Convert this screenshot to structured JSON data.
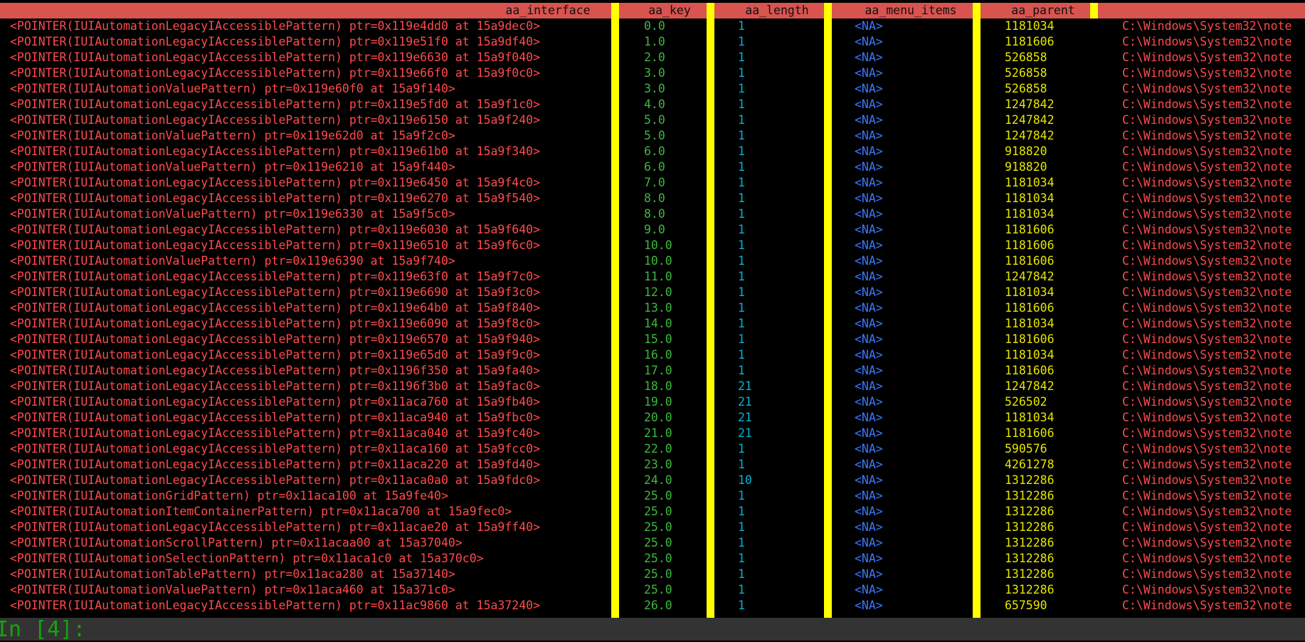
{
  "colors": {
    "header_bg": "#d9534f",
    "separator": "#ffff00",
    "interface_text": "#ff4b4b",
    "key_text": "#3cb93c",
    "length_text": "#00b4d4",
    "menu_items_text": "#3b78ff",
    "parent_text": "#e6e600",
    "path_text": "#ff4b4b",
    "prompt_text": "#14a314",
    "prompt_bg": "#333333"
  },
  "table": {
    "columns": [
      "aa_interface",
      "aa_key",
      "aa_length",
      "aa_menu_items",
      "aa_parent"
    ],
    "rows": [
      {
        "interface": "<POINTER(IUIAutomationLegacyIAccessiblePattern) ptr=0x119e4dd0 at 15a9dec0>",
        "key": "0.0",
        "length": "1",
        "menu_items": "<NA>",
        "parent": "1181034",
        "path": "C:\\Windows\\System32\\note"
      },
      {
        "interface": "<POINTER(IUIAutomationLegacyIAccessiblePattern) ptr=0x119e51f0 at 15a9df40>",
        "key": "1.0",
        "length": "1",
        "menu_items": "<NA>",
        "parent": "1181606",
        "path": "C:\\Windows\\System32\\note"
      },
      {
        "interface": "<POINTER(IUIAutomationLegacyIAccessiblePattern) ptr=0x119e6630 at 15a9f040>",
        "key": "2.0",
        "length": "1",
        "menu_items": "<NA>",
        "parent": "526858",
        "path": "C:\\Windows\\System32\\note"
      },
      {
        "interface": "<POINTER(IUIAutomationLegacyIAccessiblePattern) ptr=0x119e66f0 at 15a9f0c0>",
        "key": "3.0",
        "length": "1",
        "menu_items": "<NA>",
        "parent": "526858",
        "path": "C:\\Windows\\System32\\note"
      },
      {
        "interface": "<POINTER(IUIAutomationValuePattern) ptr=0x119e60f0 at 15a9f140>",
        "key": "3.0",
        "length": "1",
        "menu_items": "<NA>",
        "parent": "526858",
        "path": "C:\\Windows\\System32\\note"
      },
      {
        "interface": "<POINTER(IUIAutomationLegacyIAccessiblePattern) ptr=0x119e5fd0 at 15a9f1c0>",
        "key": "4.0",
        "length": "1",
        "menu_items": "<NA>",
        "parent": "1247842",
        "path": "C:\\Windows\\System32\\note"
      },
      {
        "interface": "<POINTER(IUIAutomationLegacyIAccessiblePattern) ptr=0x119e6150 at 15a9f240>",
        "key": "5.0",
        "length": "1",
        "menu_items": "<NA>",
        "parent": "1247842",
        "path": "C:\\Windows\\System32\\note"
      },
      {
        "interface": "<POINTER(IUIAutomationValuePattern) ptr=0x119e62d0 at 15a9f2c0>",
        "key": "5.0",
        "length": "1",
        "menu_items": "<NA>",
        "parent": "1247842",
        "path": "C:\\Windows\\System32\\note"
      },
      {
        "interface": "<POINTER(IUIAutomationLegacyIAccessiblePattern) ptr=0x119e61b0 at 15a9f340>",
        "key": "6.0",
        "length": "1",
        "menu_items": "<NA>",
        "parent": "918820",
        "path": "C:\\Windows\\System32\\note"
      },
      {
        "interface": "<POINTER(IUIAutomationValuePattern) ptr=0x119e6210 at 15a9f440>",
        "key": "6.0",
        "length": "1",
        "menu_items": "<NA>",
        "parent": "918820",
        "path": "C:\\Windows\\System32\\note"
      },
      {
        "interface": "<POINTER(IUIAutomationLegacyIAccessiblePattern) ptr=0x119e6450 at 15a9f4c0>",
        "key": "7.0",
        "length": "1",
        "menu_items": "<NA>",
        "parent": "1181034",
        "path": "C:\\Windows\\System32\\note"
      },
      {
        "interface": "<POINTER(IUIAutomationLegacyIAccessiblePattern) ptr=0x119e6270 at 15a9f540>",
        "key": "8.0",
        "length": "1",
        "menu_items": "<NA>",
        "parent": "1181034",
        "path": "C:\\Windows\\System32\\note"
      },
      {
        "interface": "<POINTER(IUIAutomationValuePattern) ptr=0x119e6330 at 15a9f5c0>",
        "key": "8.0",
        "length": "1",
        "menu_items": "<NA>",
        "parent": "1181034",
        "path": "C:\\Windows\\System32\\note"
      },
      {
        "interface": "<POINTER(IUIAutomationLegacyIAccessiblePattern) ptr=0x119e6030 at 15a9f640>",
        "key": "9.0",
        "length": "1",
        "menu_items": "<NA>",
        "parent": "1181606",
        "path": "C:\\Windows\\System32\\note"
      },
      {
        "interface": "<POINTER(IUIAutomationLegacyIAccessiblePattern) ptr=0x119e6510 at 15a9f6c0>",
        "key": "10.0",
        "length": "1",
        "menu_items": "<NA>",
        "parent": "1181606",
        "path": "C:\\Windows\\System32\\note"
      },
      {
        "interface": "<POINTER(IUIAutomationValuePattern) ptr=0x119e6390 at 15a9f740>",
        "key": "10.0",
        "length": "1",
        "menu_items": "<NA>",
        "parent": "1181606",
        "path": "C:\\Windows\\System32\\note"
      },
      {
        "interface": "<POINTER(IUIAutomationLegacyIAccessiblePattern) ptr=0x119e63f0 at 15a9f7c0>",
        "key": "11.0",
        "length": "1",
        "menu_items": "<NA>",
        "parent": "1247842",
        "path": "C:\\Windows\\System32\\note"
      },
      {
        "interface": "<POINTER(IUIAutomationLegacyIAccessiblePattern) ptr=0x119e6690 at 15a9f3c0>",
        "key": "12.0",
        "length": "1",
        "menu_items": "<NA>",
        "parent": "1181034",
        "path": "C:\\Windows\\System32\\note"
      },
      {
        "interface": "<POINTER(IUIAutomationLegacyIAccessiblePattern) ptr=0x119e64b0 at 15a9f840>",
        "key": "13.0",
        "length": "1",
        "menu_items": "<NA>",
        "parent": "1181606",
        "path": "C:\\Windows\\System32\\note"
      },
      {
        "interface": "<POINTER(IUIAutomationLegacyIAccessiblePattern) ptr=0x119e6090 at 15a9f8c0>",
        "key": "14.0",
        "length": "1",
        "menu_items": "<NA>",
        "parent": "1181034",
        "path": "C:\\Windows\\System32\\note"
      },
      {
        "interface": "<POINTER(IUIAutomationLegacyIAccessiblePattern) ptr=0x119e6570 at 15a9f940>",
        "key": "15.0",
        "length": "1",
        "menu_items": "<NA>",
        "parent": "1181606",
        "path": "C:\\Windows\\System32\\note"
      },
      {
        "interface": "<POINTER(IUIAutomationLegacyIAccessiblePattern) ptr=0x119e65d0 at 15a9f9c0>",
        "key": "16.0",
        "length": "1",
        "menu_items": "<NA>",
        "parent": "1181034",
        "path": "C:\\Windows\\System32\\note"
      },
      {
        "interface": "<POINTER(IUIAutomationLegacyIAccessiblePattern) ptr=0x1196f350 at 15a9fa40>",
        "key": "17.0",
        "length": "1",
        "menu_items": "<NA>",
        "parent": "1181606",
        "path": "C:\\Windows\\System32\\note"
      },
      {
        "interface": "<POINTER(IUIAutomationLegacyIAccessiblePattern) ptr=0x1196f3b0 at 15a9fac0>",
        "key": "18.0",
        "length": "21",
        "menu_items": "<NA>",
        "parent": "1247842",
        "path": "C:\\Windows\\System32\\note"
      },
      {
        "interface": "<POINTER(IUIAutomationLegacyIAccessiblePattern) ptr=0x11aca760 at 15a9fb40>",
        "key": "19.0",
        "length": "21",
        "menu_items": "<NA>",
        "parent": "526502",
        "path": "C:\\Windows\\System32\\note"
      },
      {
        "interface": "<POINTER(IUIAutomationLegacyIAccessiblePattern) ptr=0x11aca940 at 15a9fbc0>",
        "key": "20.0",
        "length": "21",
        "menu_items": "<NA>",
        "parent": "1181034",
        "path": "C:\\Windows\\System32\\note"
      },
      {
        "interface": "<POINTER(IUIAutomationLegacyIAccessiblePattern) ptr=0x11aca040 at 15a9fc40>",
        "key": "21.0",
        "length": "21",
        "menu_items": "<NA>",
        "parent": "1181606",
        "path": "C:\\Windows\\System32\\note"
      },
      {
        "interface": "<POINTER(IUIAutomationLegacyIAccessiblePattern) ptr=0x11aca160 at 15a9fcc0>",
        "key": "22.0",
        "length": "1",
        "menu_items": "<NA>",
        "parent": "590576",
        "path": "C:\\Windows\\System32\\note"
      },
      {
        "interface": "<POINTER(IUIAutomationLegacyIAccessiblePattern) ptr=0x11aca220 at 15a9fd40>",
        "key": "23.0",
        "length": "1",
        "menu_items": "<NA>",
        "parent": "4261278",
        "path": "C:\\Windows\\System32\\note"
      },
      {
        "interface": "<POINTER(IUIAutomationLegacyIAccessiblePattern) ptr=0x11aca0a0 at 15a9fdc0>",
        "key": "24.0",
        "length": "10",
        "menu_items": "<NA>",
        "parent": "1312286",
        "path": "C:\\Windows\\System32\\note"
      },
      {
        "interface": "<POINTER(IUIAutomationGridPattern) ptr=0x11aca100 at 15a9fe40>",
        "key": "25.0",
        "length": "1",
        "menu_items": "<NA>",
        "parent": "1312286",
        "path": "C:\\Windows\\System32\\note"
      },
      {
        "interface": "<POINTER(IUIAutomationItemContainerPattern) ptr=0x11aca700 at 15a9fec0>",
        "key": "25.0",
        "length": "1",
        "menu_items": "<NA>",
        "parent": "1312286",
        "path": "C:\\Windows\\System32\\note"
      },
      {
        "interface": "<POINTER(IUIAutomationLegacyIAccessiblePattern) ptr=0x11acae20 at 15a9ff40>",
        "key": "25.0",
        "length": "1",
        "menu_items": "<NA>",
        "parent": "1312286",
        "path": "C:\\Windows\\System32\\note"
      },
      {
        "interface": "<POINTER(IUIAutomationScrollPattern) ptr=0x11acaa00 at 15a37040>",
        "key": "25.0",
        "length": "1",
        "menu_items": "<NA>",
        "parent": "1312286",
        "path": "C:\\Windows\\System32\\note"
      },
      {
        "interface": "<POINTER(IUIAutomationSelectionPattern) ptr=0x11aca1c0 at 15a370c0>",
        "key": "25.0",
        "length": "1",
        "menu_items": "<NA>",
        "parent": "1312286",
        "path": "C:\\Windows\\System32\\note"
      },
      {
        "interface": "<POINTER(IUIAutomationTablePattern) ptr=0x11aca280 at 15a37140>",
        "key": "25.0",
        "length": "1",
        "menu_items": "<NA>",
        "parent": "1312286",
        "path": "C:\\Windows\\System32\\note"
      },
      {
        "interface": "<POINTER(IUIAutomationValuePattern) ptr=0x11aca460 at 15a371c0>",
        "key": "25.0",
        "length": "1",
        "menu_items": "<NA>",
        "parent": "1312286",
        "path": "C:\\Windows\\System32\\note"
      },
      {
        "interface": "<POINTER(IUIAutomationLegacyIAccessiblePattern) ptr=0x11ac9860 at 15a37240>",
        "key": "26.0",
        "length": "1",
        "menu_items": "<NA>",
        "parent": "657590",
        "path": "C:\\Windows\\System32\\note"
      }
    ]
  },
  "prompt": {
    "text": "In [4]:"
  }
}
